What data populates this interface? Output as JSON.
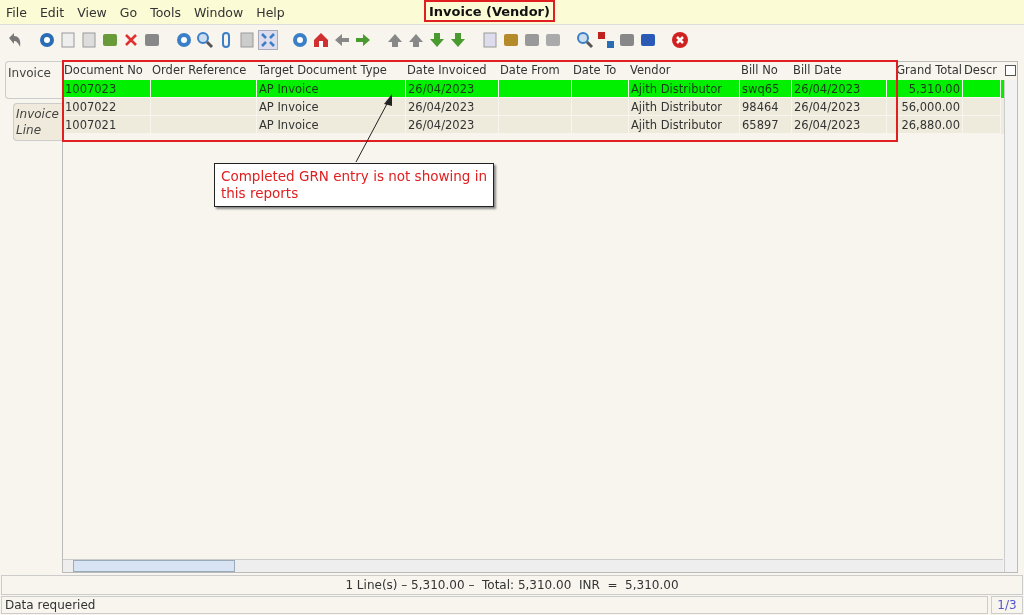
{
  "menu": [
    "File",
    "Edit",
    "View",
    "Go",
    "Tools",
    "Window",
    "Help"
  ],
  "window": {
    "title": "Invoice (Vendor)"
  },
  "tabs": [
    {
      "label": "Invoice",
      "selected": true
    },
    {
      "label": "Invoice Line",
      "selected": false
    }
  ],
  "table": {
    "columns": [
      "Document No",
      "Order Reference",
      "Target Document Type",
      "Date Invoiced",
      "Date From",
      "Date To",
      "Vendor",
      "Bill No",
      "Bill Date",
      "Grand Total",
      "Descr"
    ],
    "rows": [
      {
        "selected": true,
        "document_no": "1007023",
        "target_document_type": "AP Invoice",
        "date_invoiced": "26/04/2023",
        "vendor": "Ajith Distributor",
        "bill_no": "swq65",
        "bill_date": "26/04/2023",
        "grand_total": "5,310.00"
      },
      {
        "selected": false,
        "document_no": "1007022",
        "target_document_type": "AP Invoice",
        "date_invoiced": "26/04/2023",
        "vendor": "Ajith Distributor",
        "bill_no": "98464",
        "bill_date": "26/04/2023",
        "grand_total": "56,000.00"
      },
      {
        "selected": false,
        "document_no": "1007021",
        "target_document_type": "AP Invoice",
        "date_invoiced": "26/04/2023",
        "vendor": "Ajith Distributor",
        "bill_no": "65897",
        "bill_date": "26/04/2023",
        "grand_total": "26,880.00"
      }
    ]
  },
  "annotation": {
    "text": "Completed GRN entry is not showing in this reports"
  },
  "summary": "1 Line(s) – 5,310.00 –  Total: 5,310.00  INR  =  5,310.00",
  "status_bar": {
    "message": "Data requeried",
    "record": "1/3"
  }
}
